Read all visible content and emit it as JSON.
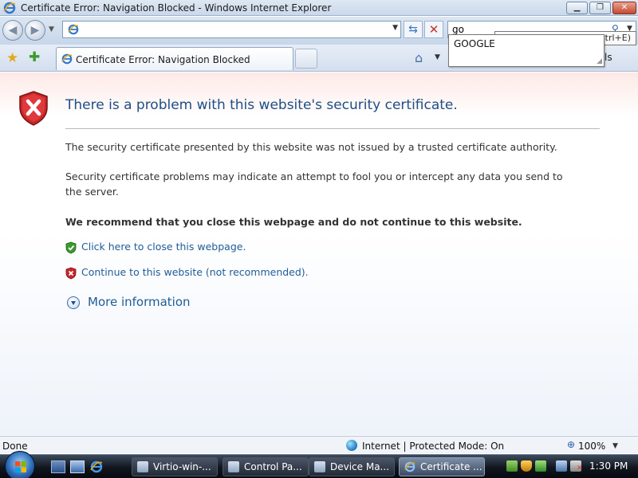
{
  "window": {
    "title": "Certificate Error: Navigation Blocked - Windows Internet Explorer"
  },
  "address_bar": {
    "url": ""
  },
  "search": {
    "query": "go",
    "suggestions": [
      "GOOGLE"
    ],
    "shortcut_hint": "Ctrl+E)"
  },
  "tabs": [
    {
      "label": "Certificate Error: Navigation Blocked",
      "active": true
    }
  ],
  "toolbar": {
    "tools_tail": "ls"
  },
  "page": {
    "headline": "There is a problem with this website's security certificate.",
    "paragraphs": [
      "The security certificate presented by this website was not issued by a trusted certificate authority.",
      "Security certificate problems may indicate an attempt to fool you or intercept any data you send to the server."
    ],
    "recommendation": "We recommend that you close this webpage and do not continue to this website.",
    "close_link": "Click here to close this webpage.",
    "continue_link": "Continue to this website (not recommended).",
    "more_info": "More information"
  },
  "status_bar": {
    "status": "Done",
    "zone": "Internet | Protected Mode: On",
    "zoom": "100%"
  },
  "taskbar": {
    "tasks": [
      {
        "label": "Virtio-win-..."
      },
      {
        "label": "Control Pa..."
      },
      {
        "label": "Device Ma..."
      },
      {
        "label": "Certificate ...",
        "active": true
      }
    ],
    "clock": "1:30 PM"
  },
  "colors": {
    "headline": "#1f4e86",
    "link": "#1f5c98",
    "error_shield": "#c8262a",
    "ok_shield": "#3a9a2e",
    "taskbar": "#11161e"
  },
  "icons": [
    "ie-icon",
    "error-shield-icon",
    "ok-shield-icon",
    "favorites-star-icon",
    "add-favorites-icon",
    "home-icon",
    "search-icon",
    "expand-icon",
    "globe-icon",
    "zoom-icon",
    "windows-start-icon"
  ]
}
